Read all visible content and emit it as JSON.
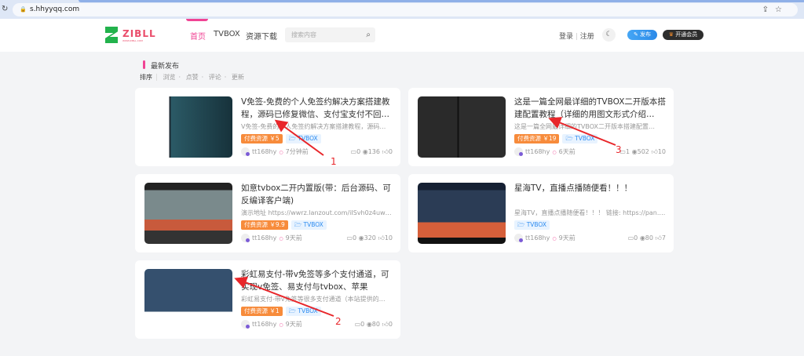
{
  "browser": {
    "url": "s.hhyyqq.com"
  },
  "header": {
    "logo_text": "ZIBLL",
    "logo_sub": "WWW.ZIBLL.COM",
    "nav": [
      {
        "label": "首页",
        "active": true
      },
      {
        "label": "TVBOX"
      },
      {
        "label": "资源下载"
      }
    ],
    "search_placeholder": "搜索内容",
    "login": "登录",
    "register": "注册",
    "publish": "发布",
    "vip": "开通会员"
  },
  "section": {
    "title": "最新发布",
    "sort_label": "排序",
    "sort_options": [
      "浏览",
      "点赞",
      "评论",
      "更新"
    ]
  },
  "colors": {
    "accent": "#f04494",
    "pay_tag": "#f78b3b",
    "cat_tag": "#2d8cf0",
    "annotation": "#e8262a"
  },
  "posts": [
    {
      "title": "V免签-免费的个人免签约解决方案搭建教程，源码已修复微信、支付宝支付不回…",
      "excerpt": "V免签-免费的个人免签约解决方案搭建教程，源码…",
      "price_tag": "付费资源 ￥5",
      "category": "TVBOX",
      "author": "tt168hy",
      "time": "7分钟前",
      "comments": "0",
      "views": "136",
      "likes": "0"
    },
    {
      "title": "这是一篇全网最详细的TVBOX二开版本搭建配置教程（详细的用图文形式介绍…",
      "excerpt": "这是一篇全网最详细的TVBOX二开版本搭建配置…",
      "price_tag": "付费资源 ￥19",
      "category": "TVBOX",
      "author": "tt168hy",
      "time": "6天前",
      "comments": "1",
      "views": "502",
      "likes": "10"
    },
    {
      "title": "如意tvbox二开内置版(带：后台源码、可反编译客户端)",
      "excerpt": "演示地址 https://wwrz.lanzout.com/iISvh0z4uw4b …",
      "price_tag": "付费资源 ￥9.9",
      "category": "TVBOX",
      "author": "tt168hy",
      "time": "9天前",
      "comments": "0",
      "views": "320",
      "likes": "10"
    },
    {
      "title": "星海TV，直播点播随便看！！！",
      "excerpt": "星海TV，直播点播随便看！！！ 链接: https://pan.…",
      "price_tag": "",
      "category": "TVBOX",
      "author": "tt168hy",
      "time": "9天前",
      "comments": "0",
      "views": "80",
      "likes": "7"
    },
    {
      "title": "彩虹易支付-带v免签等多个支付通道，可实现v免签、易支付与tvbox、苹果cms…",
      "excerpt": "彩虹易支付-带v免签等很多支付通道（本站提供的…",
      "price_tag": "付费资源 ￥1",
      "category": "TVBOX",
      "author": "tt168hy",
      "time": "9天前",
      "comments": "0",
      "views": "80",
      "likes": "0"
    }
  ],
  "annotations": [
    "1",
    "2",
    "3"
  ]
}
